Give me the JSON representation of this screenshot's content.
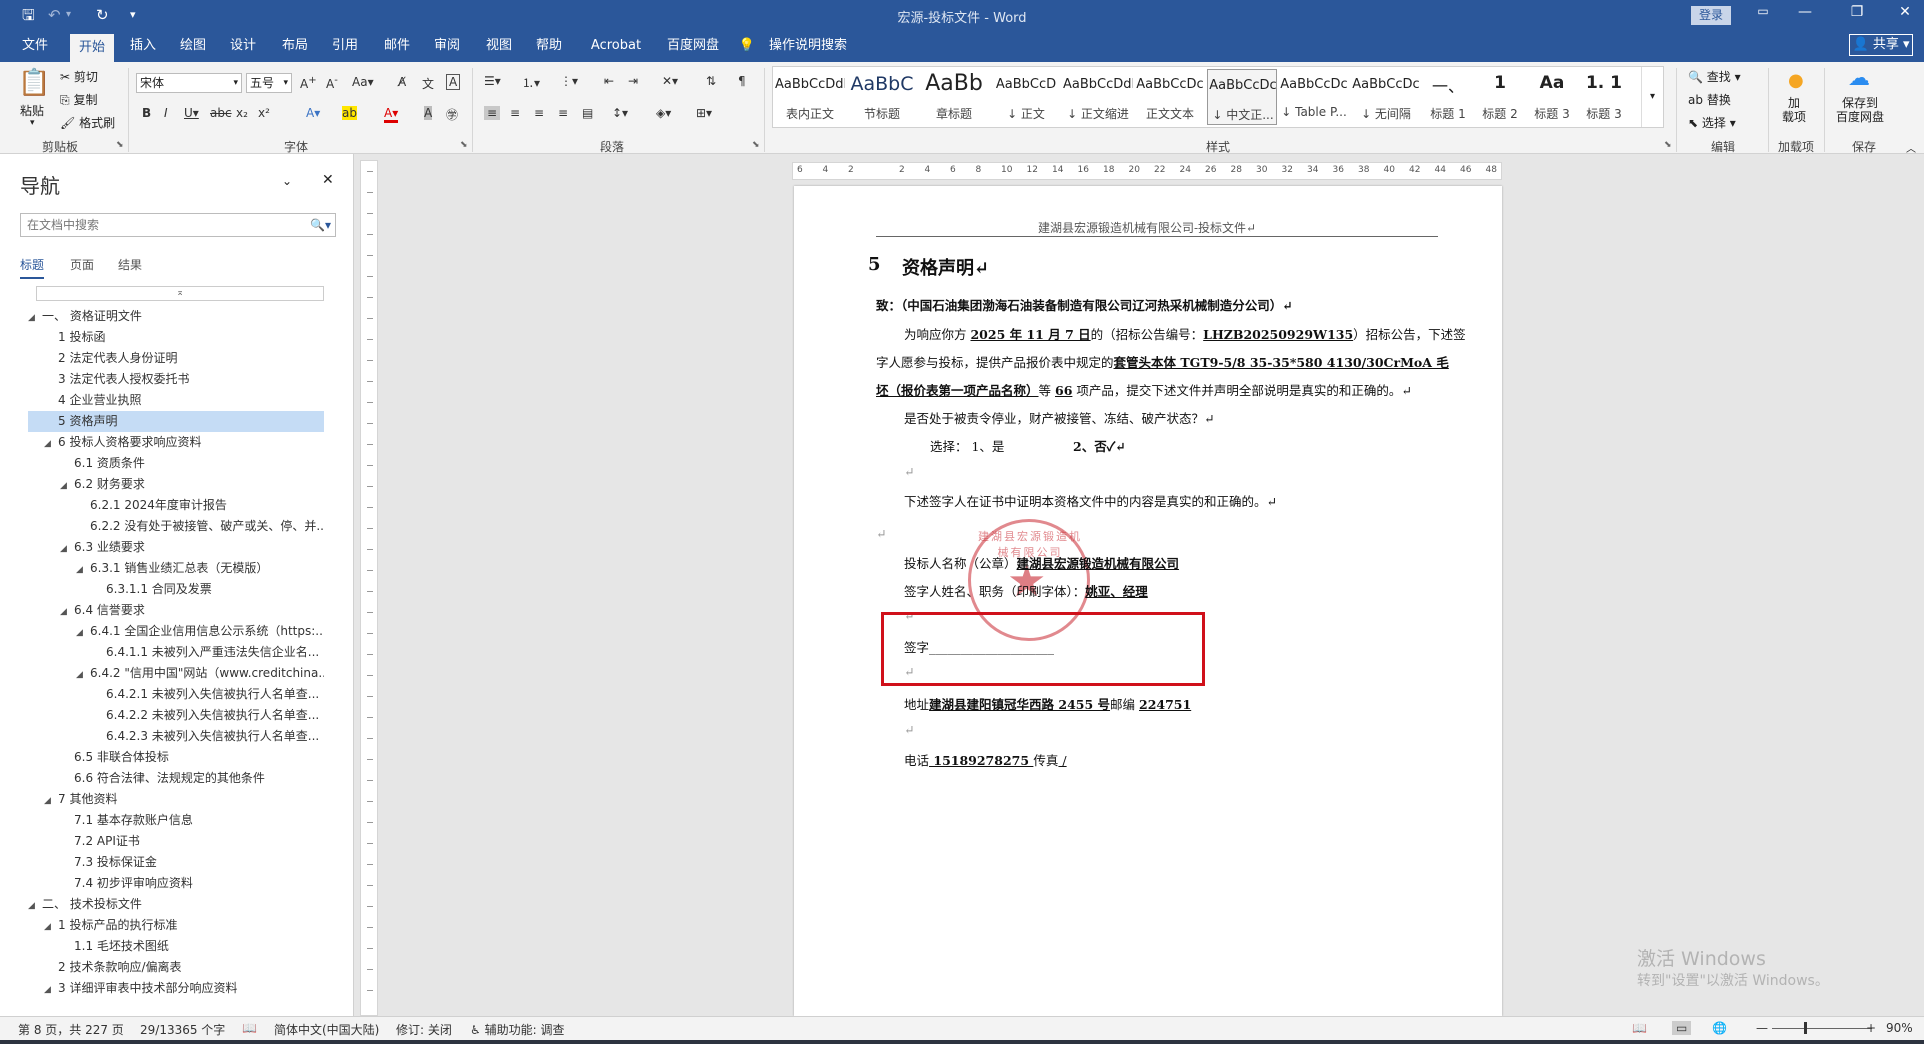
{
  "app": {
    "window_title": "宏源-投标文件  -  Word",
    "login_label": "登录",
    "share_label": "共享"
  },
  "quick_access": {
    "save_icon": "save-icon",
    "undo_icon": "undo-icon",
    "redo_icon": "redo-icon",
    "customize_icon": "customize-icon"
  },
  "tabs": [
    "文件",
    "开始",
    "插入",
    "绘图",
    "设计",
    "布局",
    "引用",
    "邮件",
    "审阅",
    "视图",
    "帮助",
    "Acrobat",
    "百度网盘",
    "操作说明搜索"
  ],
  "active_tab": "开始",
  "ribbon": {
    "clipboard": {
      "paste": "粘贴",
      "cut": "剪切",
      "copy": "复制",
      "format_painter": "格式刷",
      "label": "剪贴板"
    },
    "font": {
      "name": "宋体",
      "size": "五号",
      "label": "字体"
    },
    "paragraph": {
      "label": "段落"
    },
    "styles": {
      "label": "样式",
      "items": [
        {
          "preview": "AaBbCcDdI",
          "name": "表内正文"
        },
        {
          "preview": "AaBbC",
          "name": "节标题"
        },
        {
          "preview": "AaBb",
          "name": "章标题"
        },
        {
          "preview": "AaBbCcD",
          "name": "↓ 正文"
        },
        {
          "preview": "AaBbCcDdI",
          "name": "↓ 正文缩进"
        },
        {
          "preview": "AaBbCcDc",
          "name": "正文文本"
        },
        {
          "preview": "AaBbCcDc",
          "name": "↓ 中文正..."
        },
        {
          "preview": "AaBbCcDc",
          "name": "↓ Table P..."
        },
        {
          "preview": "AaBbCcDc",
          "name": "↓ 无间隔"
        },
        {
          "preview": "一、",
          "name": "标题 1"
        },
        {
          "preview": "1",
          "name": "标题 2"
        },
        {
          "preview": "Aa",
          "name": "标题 3"
        },
        {
          "preview": "1. 1",
          "name": "标题 3"
        }
      ]
    },
    "editing": {
      "find": "查找",
      "replace": "替换",
      "select": "选择",
      "label": "编辑"
    },
    "addins": {
      "label": "加载项",
      "button": "加\n载项"
    },
    "save_baidu": {
      "button": "保存到\n百度网盘",
      "label": "保存"
    }
  },
  "nav": {
    "title": "导航",
    "search_placeholder": "在文档中搜索",
    "tabs": [
      "标题",
      "页面",
      "结果"
    ],
    "tree": [
      {
        "level": 0,
        "caret": "◢",
        "text": "一、 资格证明文件"
      },
      {
        "level": 1,
        "caret": "",
        "text": "1 投标函"
      },
      {
        "level": 1,
        "caret": "",
        "text": "2 法定代表人身份证明"
      },
      {
        "level": 1,
        "caret": "",
        "text": "3 法定代表人授权委托书"
      },
      {
        "level": 1,
        "caret": "",
        "text": "4 企业营业执照"
      },
      {
        "level": 1,
        "caret": "",
        "text": "5 资格声明",
        "selected": true
      },
      {
        "level": 1,
        "caret": "◢",
        "text": "6 投标人资格要求响应资料"
      },
      {
        "level": 2,
        "caret": "",
        "text": "6.1 资质条件"
      },
      {
        "level": 2,
        "caret": "◢",
        "text": "6.2 财务要求"
      },
      {
        "level": 3,
        "caret": "",
        "text": "6.2.1 2024年度审计报告"
      },
      {
        "level": 3,
        "caret": "",
        "text": "6.2.2 没有处于被接管、破产或关、停、并..."
      },
      {
        "level": 2,
        "caret": "◢",
        "text": "6.3 业绩要求"
      },
      {
        "level": 3,
        "caret": "◢",
        "text": "6.3.1 销售业绩汇总表（无模版）"
      },
      {
        "level": 4,
        "caret": "",
        "text": "6.3.1.1 合同及发票"
      },
      {
        "level": 2,
        "caret": "◢",
        "text": "6.4 信誉要求"
      },
      {
        "level": 3,
        "caret": "◢",
        "text": "6.4.1 全国企业信用信息公示系统（https:..."
      },
      {
        "level": 4,
        "caret": "",
        "text": "6.4.1.1 未被列入严重违法失信企业名..."
      },
      {
        "level": 3,
        "caret": "◢",
        "text": "6.4.2 \"信用中国\"网站（www.creditchina...."
      },
      {
        "level": 4,
        "caret": "",
        "text": "6.4.2.1 未被列入失信被执行人名单查..."
      },
      {
        "level": 4,
        "caret": "",
        "text": "6.4.2.2 未被列入失信被执行人名单查..."
      },
      {
        "level": 4,
        "caret": "",
        "text": "6.4.2.3 未被列入失信被执行人名单查..."
      },
      {
        "level": 2,
        "caret": "",
        "text": "6.5 非联合体投标"
      },
      {
        "level": 2,
        "caret": "",
        "text": "6.6 符合法律、法规规定的其他条件"
      },
      {
        "level": 1,
        "caret": "◢",
        "text": "7 其他资料"
      },
      {
        "level": 2,
        "caret": "",
        "text": "7.1 基本存款账户信息"
      },
      {
        "level": 2,
        "caret": "",
        "text": "7.2 API证书"
      },
      {
        "level": 2,
        "caret": "",
        "text": "7.3 投标保证金"
      },
      {
        "level": 2,
        "caret": "",
        "text": "7.4 初步评审响应资料"
      },
      {
        "level": 0,
        "caret": "◢",
        "text": "二、 技术投标文件"
      },
      {
        "level": 1,
        "caret": "◢",
        "text": "1 投标产品的执行标准"
      },
      {
        "level": 2,
        "caret": "",
        "text": "1.1 毛坯技术图纸"
      },
      {
        "level": 1,
        "caret": "",
        "text": "2 技术条款响应/偏离表"
      },
      {
        "level": 1,
        "caret": "◢",
        "text": "3 详细评审表中技术部分响应资料"
      }
    ]
  },
  "ruler": {
    "ticks": [
      "6",
      "4",
      "2",
      "",
      "2",
      "4",
      "6",
      "8",
      "10",
      "12",
      "14",
      "16",
      "18",
      "20",
      "22",
      "24",
      "26",
      "28",
      "30",
      "32",
      "34",
      "36",
      "38",
      "40",
      "42",
      "44",
      "46",
      "48"
    ]
  },
  "document": {
    "header": "建湖县宏源锻造机械有限公司-投标文件↵",
    "heading_num": "5",
    "heading": "资格声明↵",
    "to_line": "致：（中国石油集团渤海石油装备制造有限公司辽河热采机械制造分公司）↵",
    "p1_a": "为响应你方 ",
    "p1_date": "2025 年 11 月 7 日",
    "p1_b": "的（招标公告编号：",
    "p1_code": "LHZB20250929W135",
    "p1_c": "）招标公告，下述签",
    "p2_a": "字人愿参与投标，提供产品报价表中规定的",
    "p2_item": "套管头本体 TGT9-5/8 35-35*580 4130/30CrMoA 毛",
    "p3_item": "坯（报价表第一项产品名称）",
    "p3_a": "等 ",
    "p3_qty": "66",
    "p3_b": " 项产品，提交下述文件并声明全部说明是真实的和正确的。↵",
    "q_line": "是否处于被责令停业，财产被接管、冻结、破产状态？↵",
    "choice_a": "选择： 1、是",
    "choice_b": "2、否✓↵",
    "blank1": "↵",
    "cert_line": "下述签字人在证书中证明本资格文件中的内容是真实的和正确的。↵",
    "blank2": "↵",
    "bidder_label": "投标人名称（公章）",
    "bidder_name": "建湖县宏源锻造机械有限公司",
    "signer_label": "签字人姓名、职务（印刷字体）：",
    "signer_name": "姚亚、经理",
    "blank3": "↵",
    "sign_label": "签字",
    "sign_blank": "____________________",
    "blank4": "↵",
    "addr_label": "地址",
    "addr_value": "建湖县建阳镇冠华西路 2455 号",
    "zip_label": "邮编 ",
    "zip_value": "224751",
    "blank5": "↵",
    "tel_label": "电话",
    "tel_value": "  15189278275  ",
    "fax_label": "传真",
    "fax_value": "    /    ",
    "stamp_text": "建湖县宏源锻造机械有限公司"
  },
  "watermark": {
    "line1": "激活 Windows",
    "line2": "转到\"设置\"以激活 Windows。"
  },
  "status": {
    "page": "第 8 页，共 227 页",
    "words": "29/13365 个字",
    "lang": "简体中文(中国大陆)",
    "track": "修订: 关闭",
    "accessibility": "辅助功能: 调查",
    "zoom": "90%"
  },
  "colors": {
    "brand": "#2b579a",
    "highlight_box": "#d0101a",
    "stamp": "#c82832"
  }
}
